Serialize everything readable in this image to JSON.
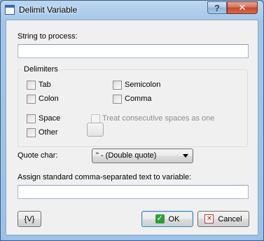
{
  "window": {
    "title": "Delimit Variable",
    "help_button": "?",
    "close_button": "✕"
  },
  "string_to_process": {
    "label": "String to process:",
    "value": ""
  },
  "delimiters": {
    "group_title": "Delimiters",
    "tab": {
      "label": "Tab",
      "checked": false
    },
    "semicolon": {
      "label": "Semicolon",
      "checked": false
    },
    "colon": {
      "label": "Colon",
      "checked": false
    },
    "comma": {
      "label": "Comma",
      "checked": false
    },
    "space": {
      "label": "Space",
      "checked": false
    },
    "treat_consecutive": {
      "label": "Treat consecutive spaces as one",
      "checked": false,
      "enabled": false
    },
    "other": {
      "label": "Other",
      "checked": false
    }
  },
  "quote_char": {
    "label": "Quote char:",
    "selected": "\" - (Double quote)"
  },
  "assign": {
    "label": "Assign standard comma-separated text to variable:",
    "value": ""
  },
  "buttons": {
    "variable": "{V}",
    "ok": "OK",
    "cancel": "Cancel"
  },
  "icons": {
    "ok": "check-icon",
    "cancel": "cancel-x-icon"
  }
}
